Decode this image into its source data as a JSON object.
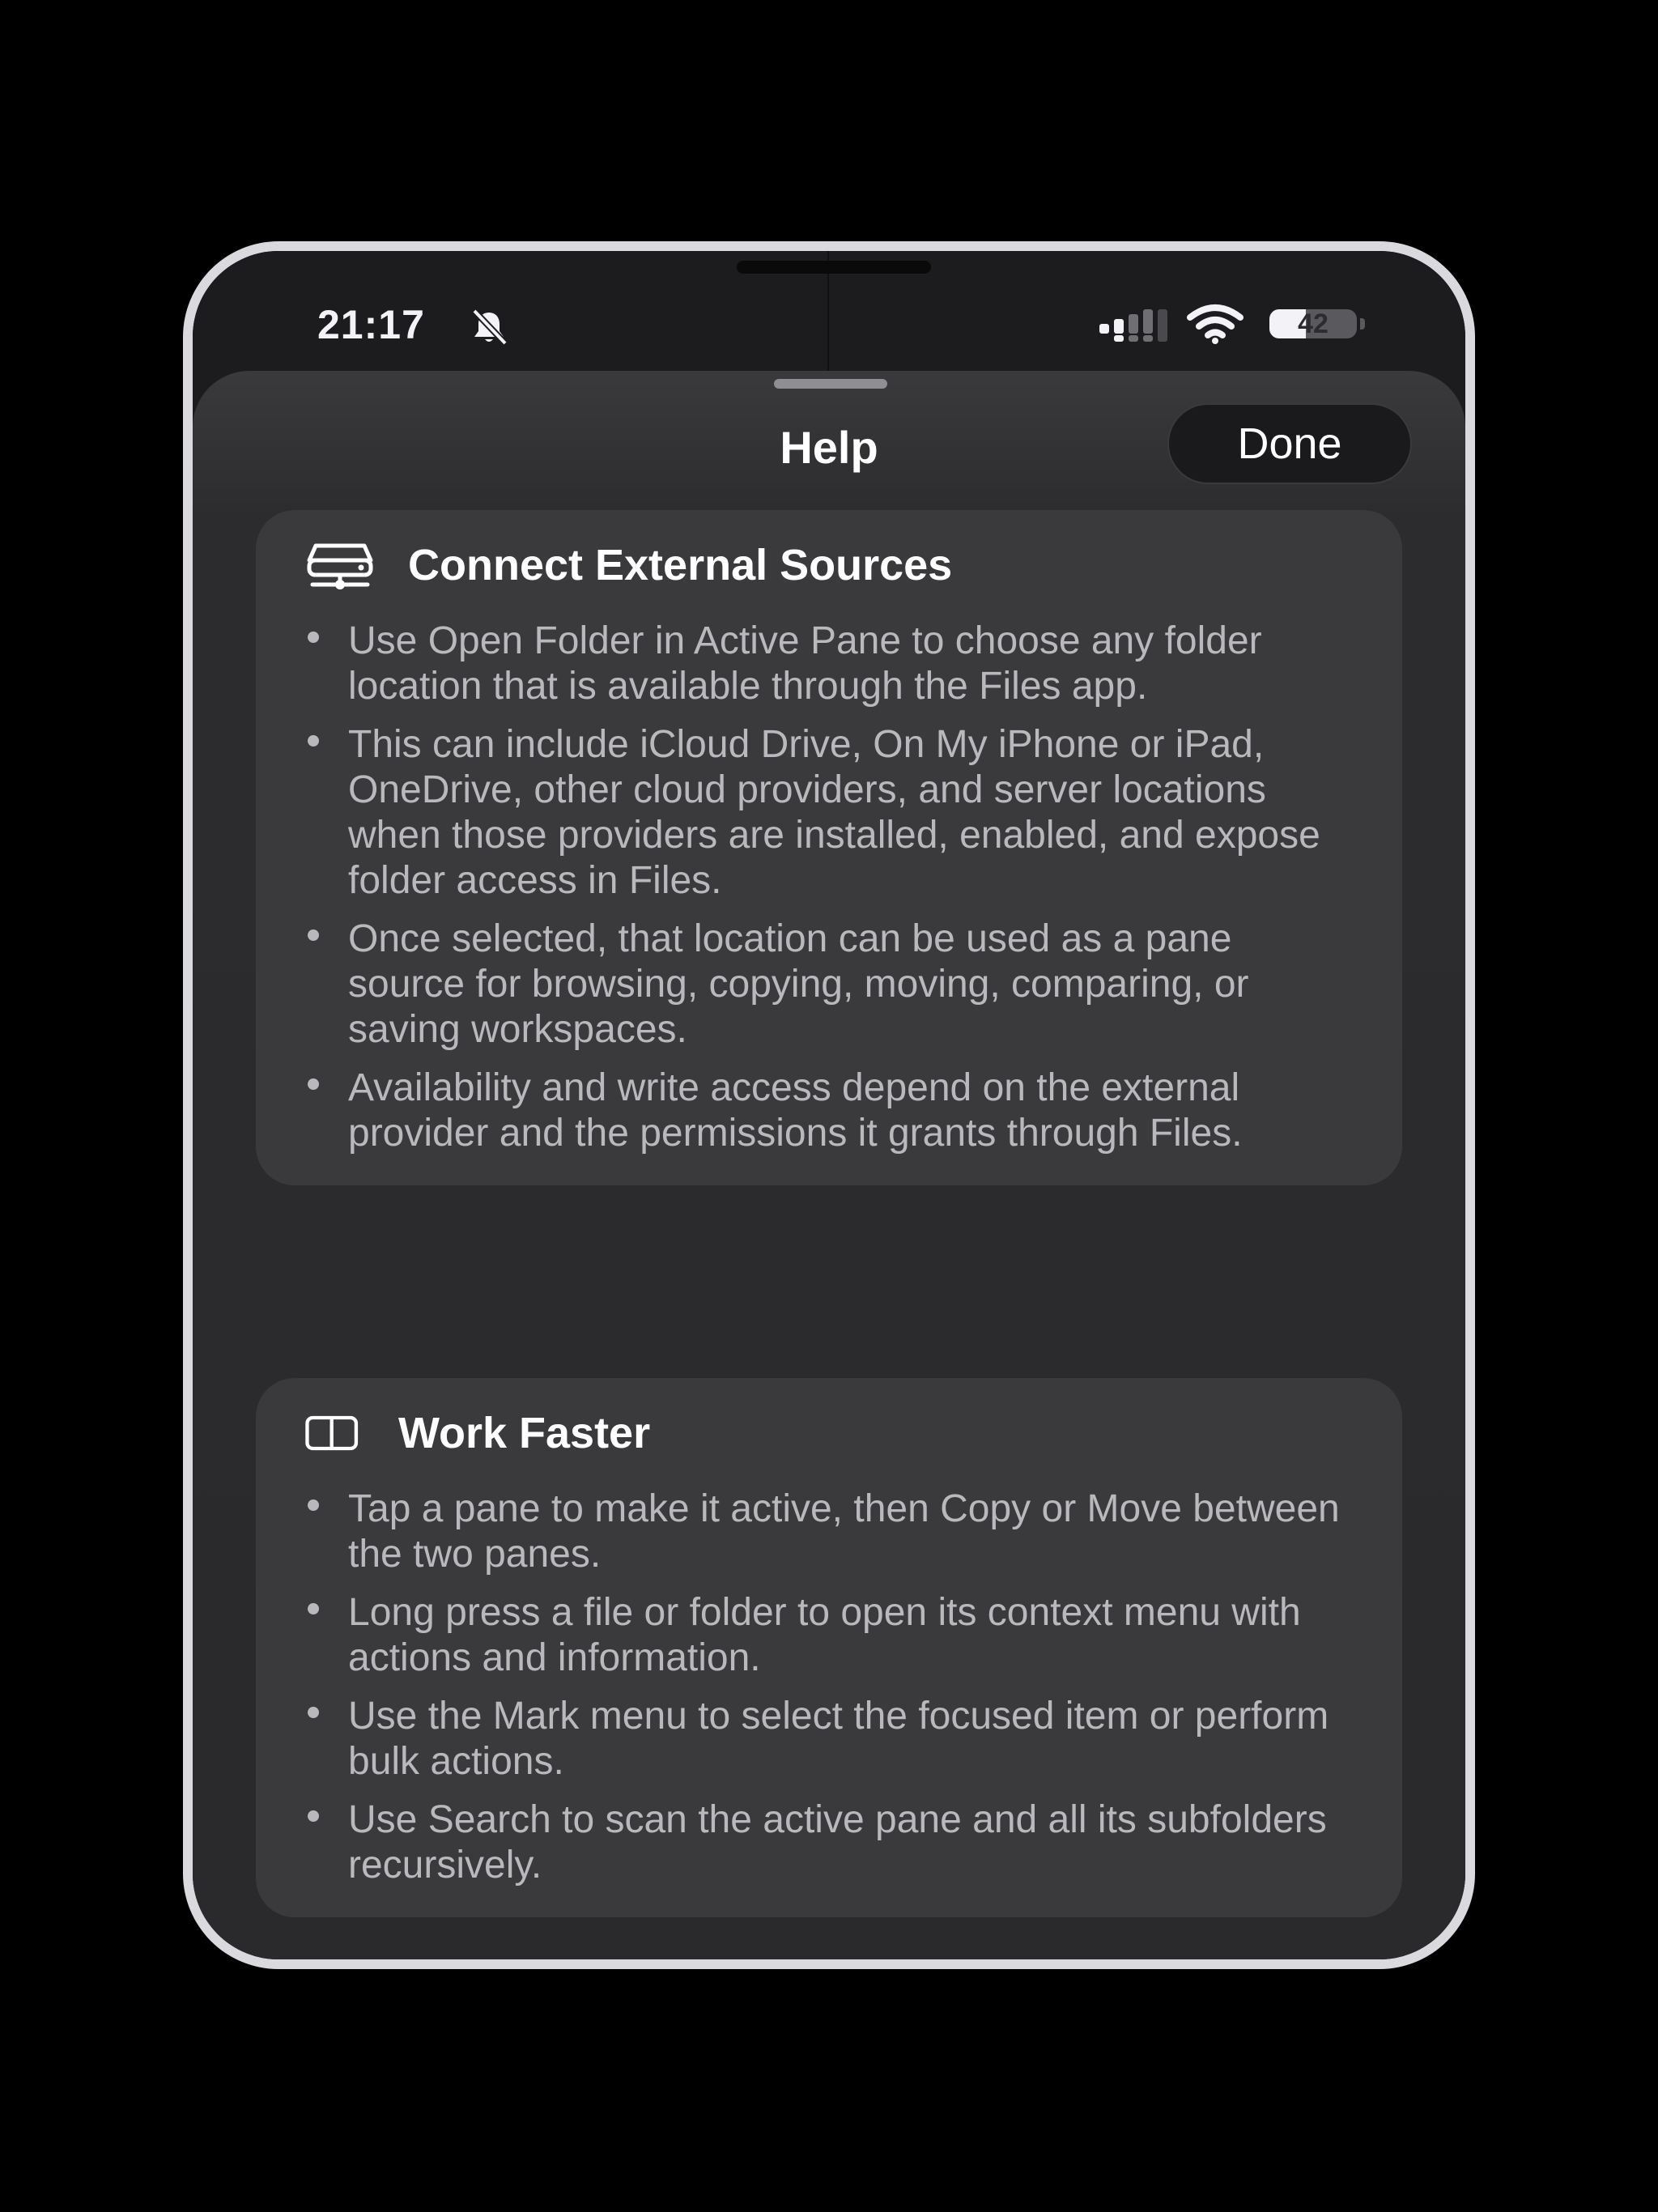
{
  "status_bar": {
    "time": "21:17",
    "battery_level": "42",
    "battery_fraction": 0.42
  },
  "sheet": {
    "title": "Help",
    "done_label": "Done"
  },
  "sections": [
    {
      "icon": "external-drive-icon",
      "title": "Connect External Sources",
      "bullets": [
        "Use Open Folder in Active Pane to choose any folder location that is available through the Files app.",
        "This can include iCloud Drive, On My iPhone or iPad, OneDrive, other cloud providers, and server locations when those providers are installed, enabled, and expose folder access in Files.",
        "Once selected, that location can be used as a pane source for browsing, copying, moving, comparing, or saving workspaces.",
        "Availability and write access depend on the external provider and the permissions it grants through Files."
      ]
    },
    {
      "icon": "split-pane-icon",
      "title": "Work Faster",
      "bullets": [
        "Tap a pane to make it active, then Copy or Move between the two panes.",
        "Long press a file or folder to open its context menu with actions and information.",
        "Use the Mark menu to select the focused item or perform bulk actions.",
        "Use Search to scan the active pane and all its subfolders recursively."
      ]
    }
  ]
}
